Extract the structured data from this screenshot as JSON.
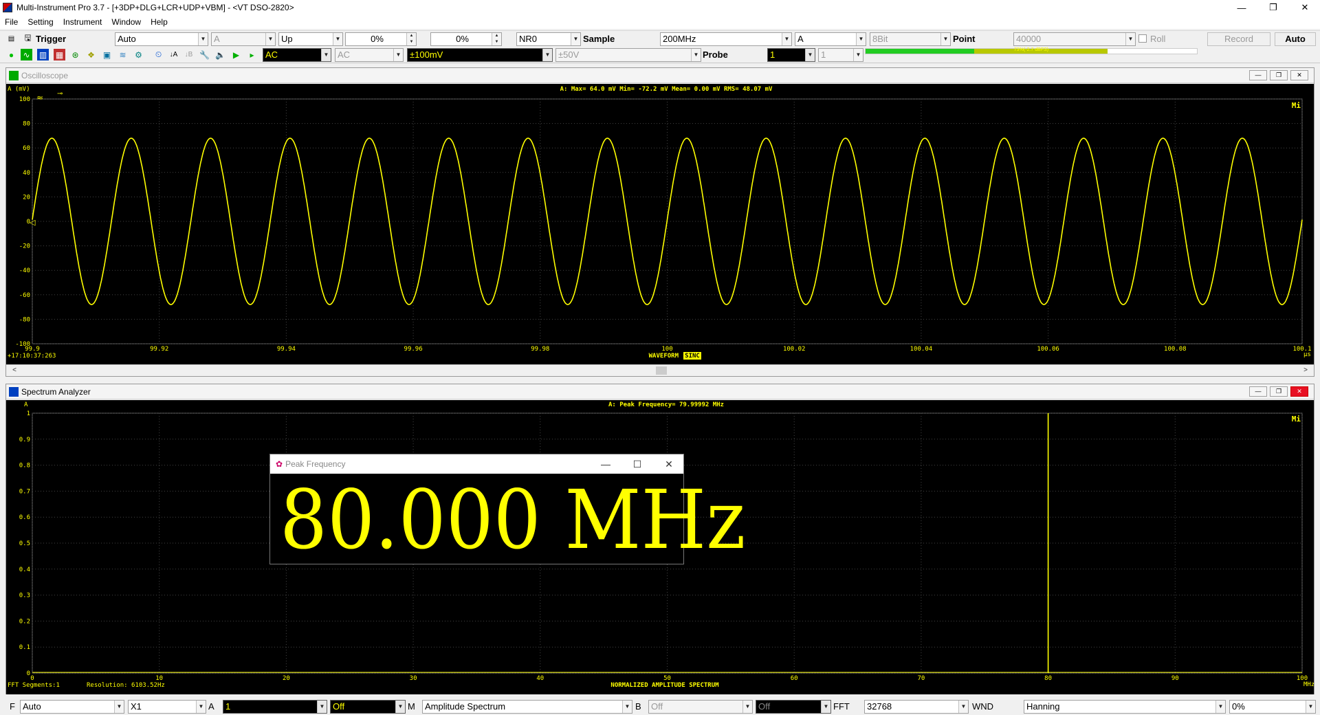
{
  "window": {
    "title": "Multi-Instrument Pro 3.7  -  [+3DP+DLG+LCR+UDP+VBM]  -  <VT DSO-2820>",
    "minimize": "—",
    "restore": "❐",
    "close": "✕"
  },
  "menu": [
    "File",
    "Setting",
    "Instrument",
    "Window",
    "Help"
  ],
  "toolbar1": {
    "trigger_label": "Trigger",
    "trigger_mode": "Auto",
    "trigger_channel": "A",
    "trigger_edge": "Up",
    "trigger_level": "0%",
    "trigger_pretrigger": "0%",
    "noise_reject": "NR0",
    "sample_label": "Sample",
    "sample_rate": "200MHz",
    "sample_channel": "A",
    "bit_depth": "8Bit",
    "point_label": "Point",
    "points": "40000",
    "roll_label": "Roll",
    "record_label": "Record",
    "auto_label": "Auto"
  },
  "toolbar2": {
    "coupling_a": "AC",
    "coupling_b": "AC",
    "range_a": "±100mV",
    "range_b": "±50V",
    "probe_label": "Probe",
    "probe_a": "1",
    "probe_b": "1",
    "buffer_text": "73%(-2.7 dBFS)",
    "buffer_level": 0.73
  },
  "oscilloscope": {
    "panel_title": "Oscilloscope",
    "channel_label": "A (mV)",
    "stats": "A: Max=  64.0 mV  Min= -72.2 mV  Mean=   0.00 mV  RMS=  48.07 mV",
    "timestamp": "+17:10:37:263",
    "mode_label": "WAVEFORM",
    "interp_label": "SINC",
    "x_unit": "μs",
    "y_ticks": [
      "100",
      "80",
      "60",
      "40",
      "20",
      "0",
      "-20",
      "-40",
      "-60",
      "-80",
      "-100"
    ],
    "x_ticks": [
      "99.9",
      "99.92",
      "99.94",
      "99.96",
      "99.98",
      "100",
      "100.02",
      "100.04",
      "100.06",
      "100.08",
      "100.1"
    ],
    "corner_mark": "Mi",
    "colors": {
      "trace": "#ffff00",
      "bg": "#000000",
      "grid": "#555555"
    }
  },
  "spectrum": {
    "panel_title": "Spectrum Analyzer",
    "channel_label": "A",
    "peak_readout": "A: Peak Frequency= 79.99992 MHz",
    "fft_segments": "FFT Segments:1",
    "resolution": "Resolution: 6103.52Hz",
    "mode_label": "NORMALIZED AMPLITUDE SPECTRUM",
    "x_unit": "MHz",
    "y_ticks": [
      "1",
      "0.9",
      "0.8",
      "0.7",
      "0.6",
      "0.5",
      "0.4",
      "0.3",
      "0.2",
      "0.1",
      "0"
    ],
    "x_ticks": [
      "0",
      "10",
      "20",
      "30",
      "40",
      "50",
      "60",
      "70",
      "80",
      "90",
      "100"
    ],
    "corner_mark": "Mi"
  },
  "peak_dialog": {
    "title": "Peak Frequency",
    "value": "80.000  MHz"
  },
  "bottombar": {
    "f_label": "F",
    "f_mode": "Auto",
    "zoom": "X1",
    "a_label": "A",
    "a_avg": "1",
    "a_off": "Off",
    "m_label": "M",
    "m_mode": "Amplitude Spectrum",
    "b_label": "B",
    "b_off1": "Off",
    "b_off2": "Off",
    "fft_label": "FFT",
    "fft_size": "32768",
    "wnd_label": "WND",
    "window_fn": "Hanning",
    "overlap": "0%"
  },
  "chart_data": [
    {
      "type": "line",
      "ylabel": "A (mV)",
      "xlabel": "μs",
      "xlim": [
        99.9,
        100.1
      ],
      "ylim": [
        -100,
        100
      ],
      "grid": true,
      "series": [
        {
          "frequency_mhz": 80,
          "amplitude_mv": 68,
          "max": 64.0,
          "min": -72.2,
          "rms": 48.07
        }
      ]
    },
    {
      "type": "line",
      "ylabel": "A",
      "xlabel": "MHz",
      "xlim": [
        0,
        100
      ],
      "ylim": [
        0,
        1
      ],
      "grid": true,
      "series": [
        {
          "x": [
            79.99992
          ],
          "values": [
            1.0
          ]
        }
      ]
    }
  ]
}
